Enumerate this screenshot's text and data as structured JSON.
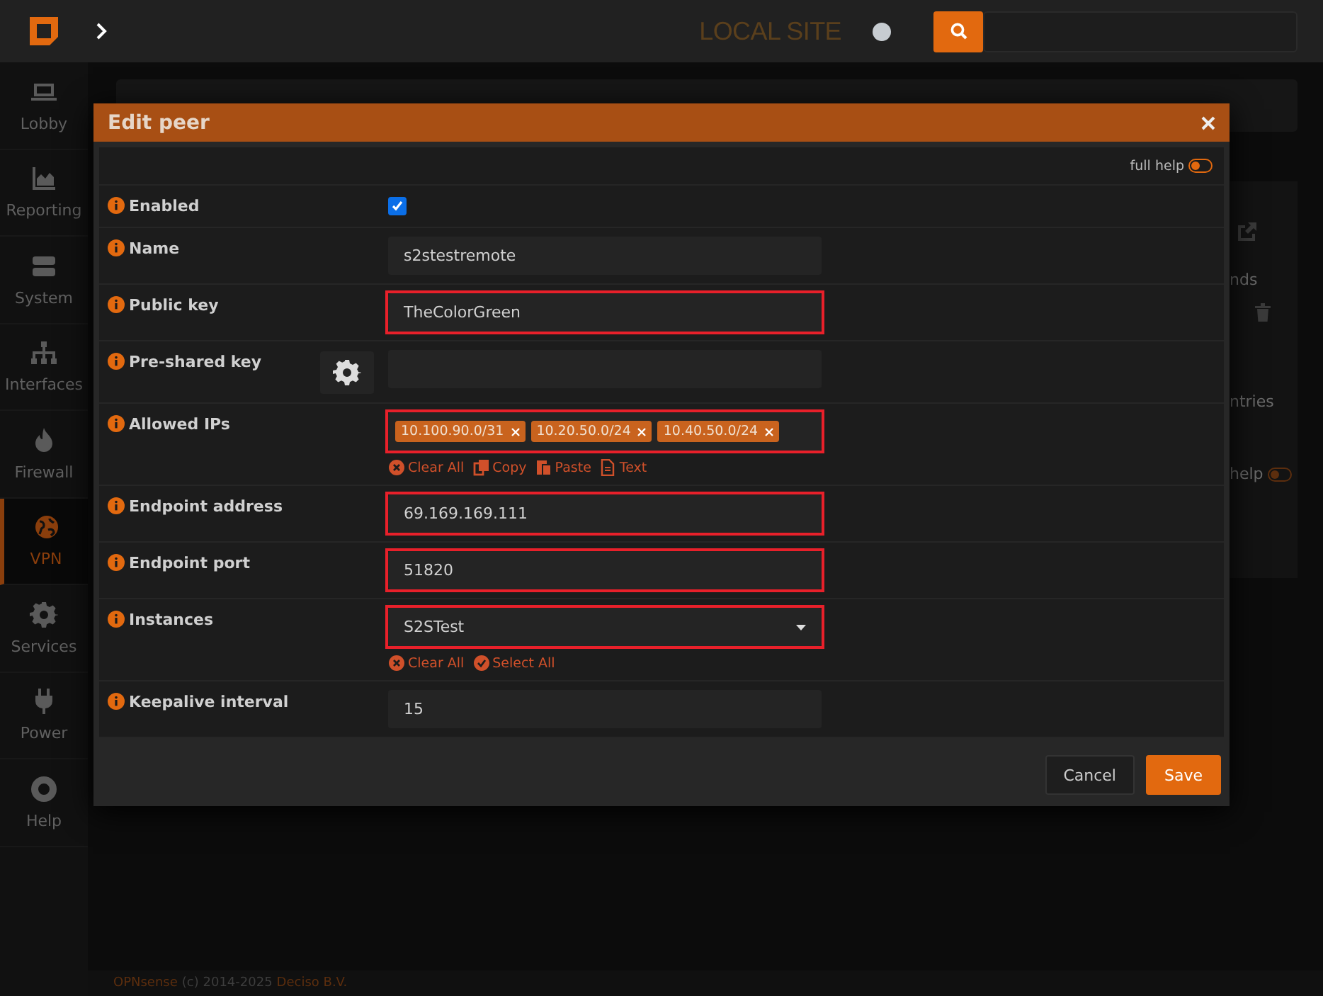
{
  "topbar": {
    "site": "LOCAL SITE"
  },
  "sidebar": {
    "items": [
      {
        "label": "Lobby",
        "selected": false
      },
      {
        "label": "Reporting",
        "selected": false
      },
      {
        "label": "System",
        "selected": false
      },
      {
        "label": "Interfaces",
        "selected": false
      },
      {
        "label": "Firewall",
        "selected": false
      },
      {
        "label": "VPN",
        "selected": true
      },
      {
        "label": "Services",
        "selected": false
      },
      {
        "label": "Power",
        "selected": false
      },
      {
        "label": "Help",
        "selected": false
      }
    ]
  },
  "page": {
    "side_texts": [
      "nds",
      "ntries"
    ],
    "side_help": {
      "label": "help",
      "on": false
    }
  },
  "dialog": {
    "title": "Edit peer",
    "full_help": {
      "label": "full help",
      "on": false
    },
    "fields": [
      {
        "kind": "checkbox",
        "label": "Enabled",
        "checked": true,
        "highlighted": false
      },
      {
        "kind": "text",
        "label": "Name",
        "value": "s2stestremote",
        "highlighted": false
      },
      {
        "kind": "text",
        "label": "Public key",
        "value": "TheColorGreen",
        "highlighted": true
      },
      {
        "kind": "generate",
        "label": "Pre-shared key",
        "highlighted": false
      },
      {
        "kind": "tags",
        "label": "Allowed IPs",
        "tags": [
          "10.100.90.0/31",
          "10.20.50.0/24",
          "10.40.50.0/24"
        ],
        "actions": [
          "Clear All",
          "Copy",
          "Paste",
          "Text"
        ],
        "highlighted": true
      },
      {
        "kind": "text",
        "label": "Endpoint address",
        "value": "69.169.169.111",
        "highlighted": true
      },
      {
        "kind": "text",
        "label": "Endpoint port",
        "value": "51820",
        "highlighted": true
      },
      {
        "kind": "select",
        "label": "Instances",
        "value": "S2STest",
        "actions": [
          "Clear All",
          "Select All"
        ],
        "highlighted": true
      },
      {
        "kind": "text",
        "label": "Keepalive interval",
        "value": "15",
        "highlighted": false
      }
    ],
    "buttons": [
      {
        "label": "Cancel",
        "primary": false
      },
      {
        "label": "Save",
        "primary": true
      }
    ]
  },
  "footer": {
    "brand": "OPNsense",
    "text": "(c) 2014-2025",
    "company": "Deciso B.V."
  }
}
